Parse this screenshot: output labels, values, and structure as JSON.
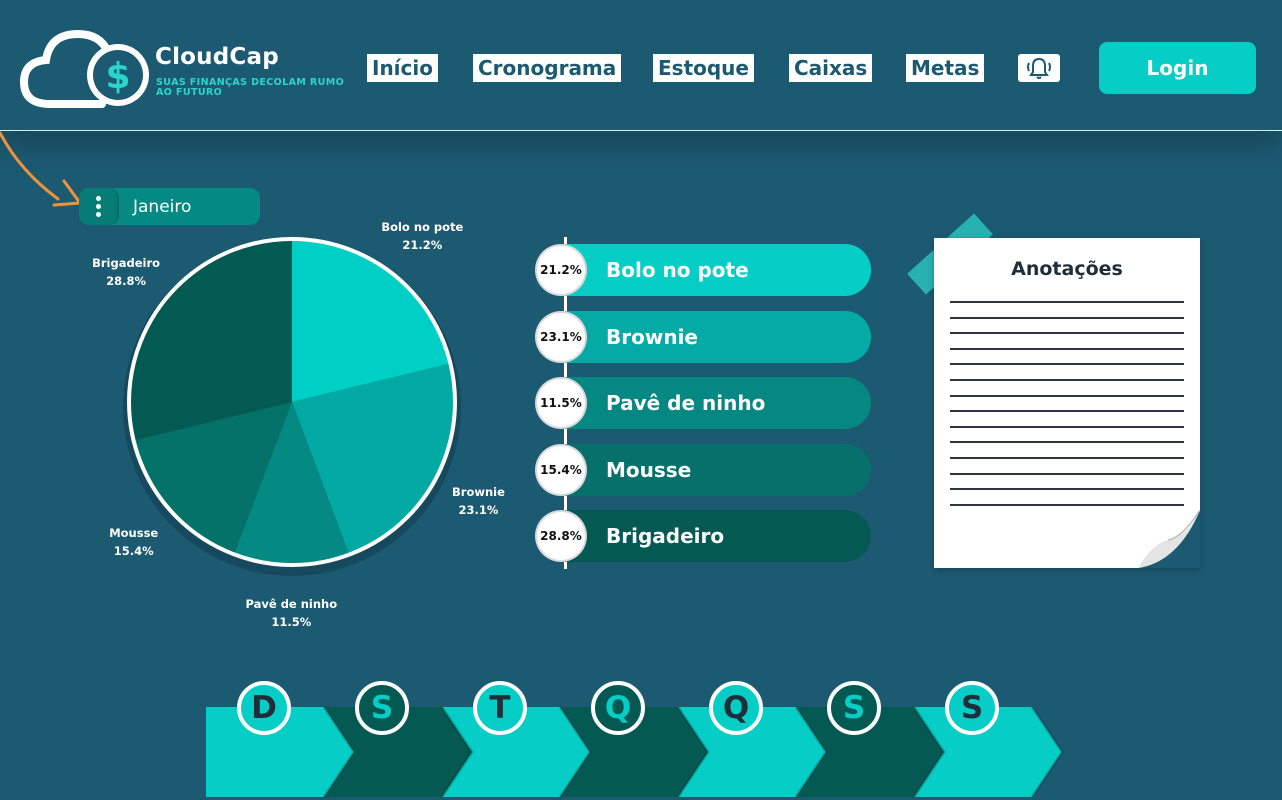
{
  "header": {
    "brand_name": "CloudCap",
    "tagline": "SUAS FINANÇAS DECOLAM RUMO AO FUTURO",
    "logo_icon": "cloud-dollar-logo",
    "nav": [
      "Início",
      "Cronograma",
      "Estoque",
      "Caixas",
      "Metas"
    ],
    "bell_icon": "bell-ringing-icon",
    "login_label": "Login"
  },
  "month_selector": {
    "menu_icon": "vertical-dots-icon",
    "label": "Janeiro"
  },
  "chart_data": {
    "type": "pie",
    "categories": [
      "Bolo no pote",
      "Brownie",
      "Pavê de ninho",
      "Mousse",
      "Brigadeiro"
    ],
    "values": [
      21.2,
      23.1,
      11.5,
      15.4,
      28.8
    ],
    "value_labels": [
      "21.2%",
      "23.1%",
      "11.5%",
      "15.4%",
      "28.8%"
    ],
    "colors": [
      "#00cfc6",
      "#03aaa3",
      "#048a82",
      "#047268",
      "#035a52"
    ]
  },
  "legend": [
    {
      "pct": "21.2%",
      "name": "Bolo no pote",
      "color": "#06cec6"
    },
    {
      "pct": "23.1%",
      "name": "Brownie",
      "color": "#05aaa4"
    },
    {
      "pct": "11.5%",
      "name": "Pavê de ninho",
      "color": "#068882"
    },
    {
      "pct": "15.4%",
      "name": "Mousse",
      "color": "#05716a"
    },
    {
      "pct": "28.8%",
      "name": "Brigadeiro",
      "color": "#045a53"
    }
  ],
  "notes": {
    "title": "Anotações"
  },
  "week": {
    "days": [
      "D",
      "S",
      "T",
      "Q",
      "Q",
      "S",
      "S"
    ],
    "colors": {
      "light": "#06cec6",
      "dark": "#045a53"
    }
  },
  "colors": {
    "background": "#1c5a72",
    "accent": "#06cec6",
    "arrow": "#f0923a"
  }
}
